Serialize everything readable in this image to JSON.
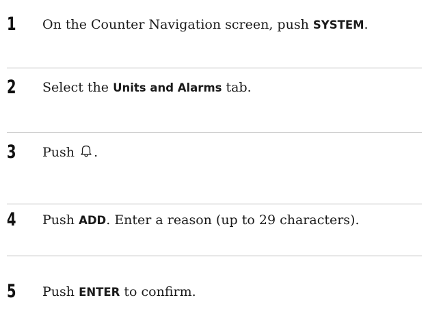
{
  "steps": [
    {
      "number": "1",
      "before": "On the Counter Navigation screen, push ",
      "keyword": "SYSTEM",
      "after": "."
    },
    {
      "number": "2",
      "before": "Select the ",
      "keyword": "Units and Alarms",
      "after": " tab."
    },
    {
      "number": "3",
      "before": "Push ",
      "icon": "bell-icon",
      "after": "."
    },
    {
      "number": "4",
      "before": "Push ",
      "keyword": "ADD",
      "after": ". Enter a reason (up to 29 characters)."
    },
    {
      "number": "5",
      "before": "Push ",
      "keyword": "ENTER",
      "after": " to confirm."
    }
  ]
}
